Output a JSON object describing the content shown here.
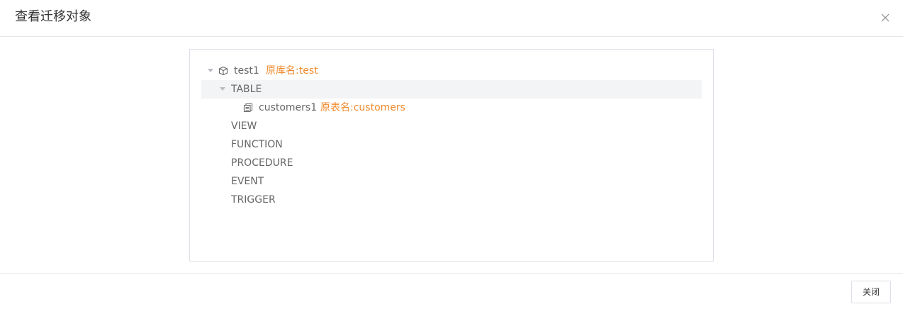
{
  "dialog": {
    "title": "查看迁移对象",
    "close_icon": "close-icon",
    "close_button_label": "关闭"
  },
  "tree": {
    "root": {
      "label": "test1",
      "origin": "原库名:test",
      "icon": "database-cube-icon",
      "expanded": true
    },
    "table_group": {
      "label": "TABLE",
      "expanded": true,
      "selected": true
    },
    "table_item": {
      "label": "customers1",
      "origin": "原表名:customers",
      "icon": "table-file-icon"
    },
    "groups": [
      "VIEW",
      "FUNCTION",
      "PROCEDURE",
      "EVENT",
      "TRIGGER"
    ]
  },
  "colors": {
    "accent_orange": "#f08a2c",
    "selected_row_bg": "#f3f4f6",
    "text": "#666666",
    "border": "#dcdfe6"
  }
}
